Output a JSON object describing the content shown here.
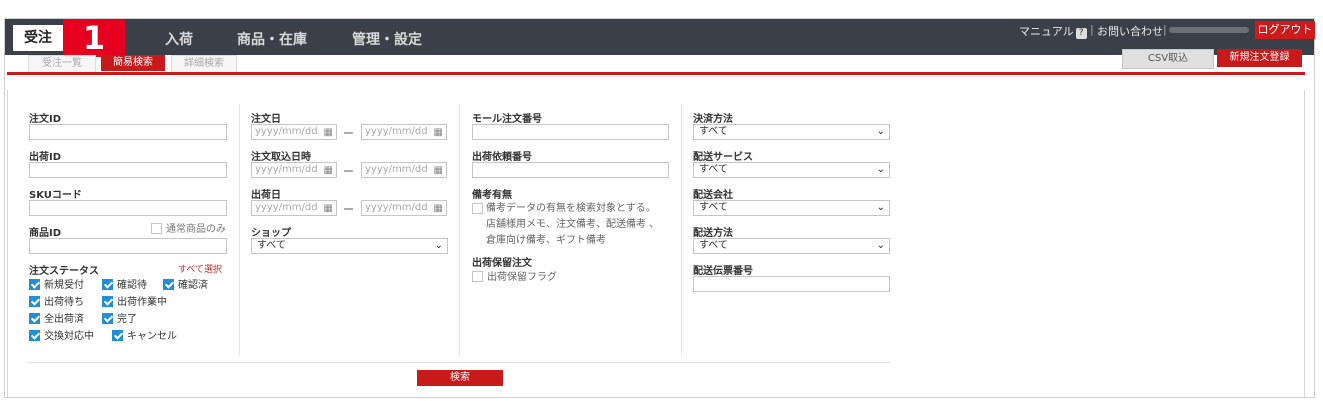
{
  "nav": {
    "brand": "受注",
    "badge": "1",
    "items": [
      "入荷",
      "商品・在庫",
      "管理・設定"
    ],
    "manual": "マニュアル",
    "help": "?",
    "contact": "お問い合わせ",
    "logout": "ログアウト"
  },
  "subtabs": [
    "受注一覧",
    "簡易検索",
    "詳細検索"
  ],
  "actions": {
    "csv": "CSV取込",
    "new_order": "新規注文登録"
  },
  "col1": {
    "order_id": "注文ID",
    "shipment_id": "出荷ID",
    "sku_code": "SKUコード",
    "product_id": "商品ID",
    "normal_only": "通常商品のみ",
    "status_label": "注文ステータス",
    "select_all": "すべて選択",
    "statuses": [
      "新規受付",
      "確認待",
      "確認済",
      "出荷待ち",
      "出荷作業中",
      "全出荷済",
      "完了",
      "交換対応中",
      "キャンセル"
    ]
  },
  "col2": {
    "order_date": "注文日",
    "import_datetime": "注文取込日時",
    "ship_date": "出荷日",
    "date_placeholder": "yyyy/mm/dd",
    "dash": "ー",
    "shop": "ショップ",
    "shop_value": "すべて"
  },
  "col3": {
    "mall_order_no": "モール注文番号",
    "ship_request_no": "出荷依頼番号",
    "remarks_label": "備考有無",
    "remarks_note": "備考データの有無を検索対象とする。店舗様用メモ、注文備考、配送備考 、倉庫向け備考、ギフト備考",
    "hold_label": "出荷保留注文",
    "hold_flag": "出荷保留フラグ"
  },
  "col4": {
    "payment": "決済方法",
    "delivery_service": "配送サービス",
    "carrier": "配送会社",
    "delivery_method": "配送方法",
    "tracking_no": "配送伝票番号",
    "all": "すべて"
  },
  "search_button": "検索",
  "colors": {
    "nav_bg": "#3b4048",
    "accent_red": "#c81a1a",
    "badge_red": "#e60020",
    "check_blue": "#1f8fd6"
  }
}
